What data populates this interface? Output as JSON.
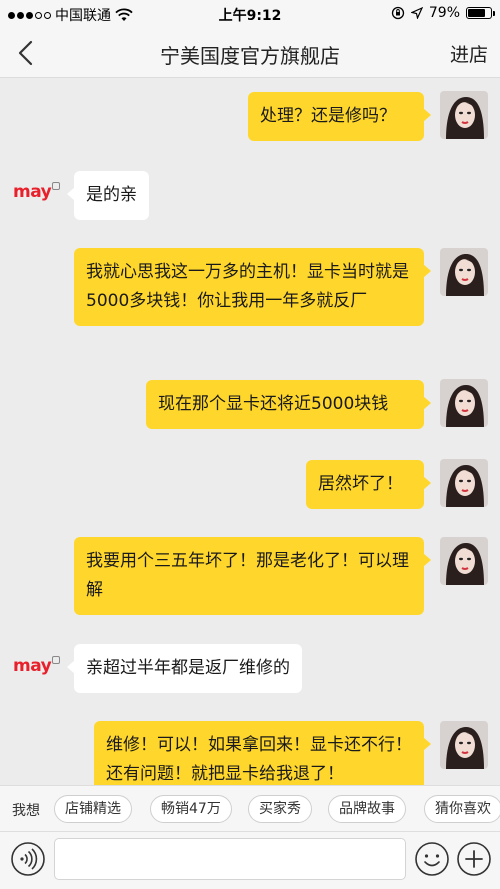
{
  "status_bar": {
    "carrier": "中国联通",
    "time": "上午9:12",
    "battery": "79%",
    "battery_level": 0.79
  },
  "nav": {
    "title": "宁美国度官方旗舰店",
    "action": "进店"
  },
  "shop": {
    "logo_text": "may"
  },
  "messages": [
    {
      "from": "user",
      "text": "处理？还是修吗？"
    },
    {
      "from": "shop",
      "text": "是的亲"
    },
    {
      "from": "user",
      "text": "我就心思我这一万多的主机！显卡当时就是5000多块钱！你让我用一年多就反厂"
    },
    {
      "from": "user",
      "text": "现在那个显卡还将近5000块钱"
    },
    {
      "from": "user",
      "text": "居然坏了！"
    },
    {
      "from": "user",
      "text": "我要用个三五年坏了！那是老化了！可以理解"
    },
    {
      "from": "shop",
      "text": "亲超过半年都是返厂维修的"
    },
    {
      "from": "user",
      "text": "维修！可以！如果拿回来！显卡还不行！还有问题！就把显卡给我退了！"
    }
  ],
  "quick_replies": {
    "label": "我想",
    "chips": [
      "店铺精选",
      "畅销47万",
      "买家秀",
      "品牌故事",
      "猜你喜欢"
    ]
  },
  "input": {
    "placeholder": ""
  },
  "colors": {
    "user_bubble": "#ffd72c",
    "shop_bubble": "#ffffff",
    "brand_red": "#e8202b",
    "background": "#ececec"
  }
}
